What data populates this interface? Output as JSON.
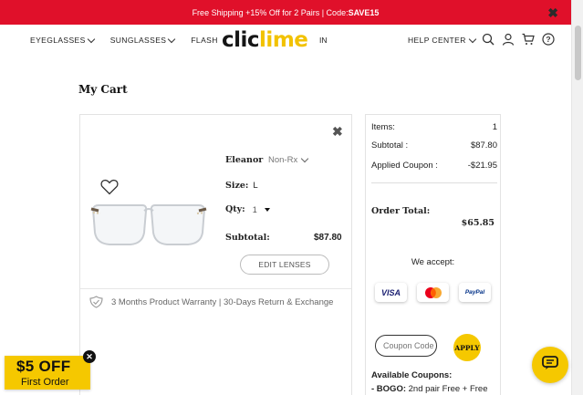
{
  "promo_bar": {
    "text": "Free Shipping +15% Off for 2 Pairs | Code: ",
    "code": "SAVE15",
    "close_icon": "close-icon"
  },
  "header": {
    "nav": [
      {
        "label": "EYEGLASSES"
      },
      {
        "label": "SUNGLASSES"
      },
      {
        "label": "FLASH SA"
      }
    ],
    "nav_tail": "IN",
    "logo": {
      "part1": "clic",
      "part2": "lime"
    },
    "help_center": "HELP CENTER",
    "icons": [
      "search-icon",
      "user-icon",
      "cart-icon",
      "help-icon"
    ]
  },
  "page": {
    "title": "My Cart"
  },
  "cart_item": {
    "name": "Eleanor",
    "lens_type": "Non-Rx",
    "size_label": "Size:",
    "size_value": "L",
    "qty_label": "Qty:",
    "qty_value": "1",
    "subtotal_label": "Subtotal:",
    "subtotal_value": "$87.80",
    "edit_lenses": "EDIT LENSES",
    "warranty": "3 Months Product Warranty | 30-Days Return & Exchange"
  },
  "summary": {
    "items_label": "Items:",
    "items_value": "1",
    "subtotal_label": "Subtotal :",
    "subtotal_value": "$87.80",
    "coupon_label": "Applied Coupon :",
    "coupon_value": "-$21.95",
    "total_label": "Order Total:",
    "total_value": "$65.85",
    "we_accept": "We accept:",
    "payment_methods": [
      "VISA",
      "Mastercard",
      "PayPal"
    ],
    "coupon_placeholder": "Coupon Code",
    "apply_label": "APPLY",
    "available_coupons": "Available Coupons:",
    "bogo_label": "- BOGO:",
    "bogo_text": " 2nd pair Free + Free"
  },
  "floating_promo": {
    "amount": "$5 OFF",
    "subtitle": "First Order"
  },
  "colors": {
    "promo_red": "#e0102a",
    "accent_yellow": "#f5c800"
  }
}
